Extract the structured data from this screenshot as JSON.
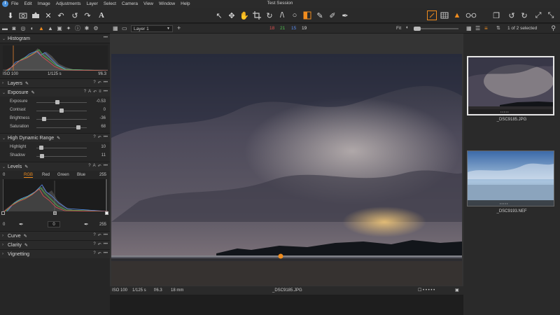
{
  "window_title": "Test Session",
  "menu": [
    "File",
    "Edit",
    "Image",
    "Adjustments",
    "Layer",
    "Select",
    "Camera",
    "View",
    "Window",
    "Help"
  ],
  "colors": {
    "accent": "#f08c1e",
    "panel_bg": "#262626",
    "toolbar_bg": "#2a2a2a"
  },
  "toolbar": {
    "left_icons": [
      "import-icon",
      "camera-icon",
      "export-icon",
      "delete-icon",
      "undo-icon",
      "rotate-left-icon",
      "redo-icon",
      "text-icon"
    ],
    "center_icons": [
      "pointer-icon",
      "pan-icon",
      "hand-icon",
      "crop-icon",
      "rotate-icon",
      "keystone-icon",
      "spot-icon",
      "mask-icon",
      "brush-icon",
      "eraser-icon",
      "gradient-icon",
      "picker-icon"
    ],
    "right_icons": [
      "proof-icon",
      "grid-icon",
      "warning-icon",
      "glasses-icon",
      "copy-icon",
      "reset-icon",
      "sync-icon",
      "expand-icon",
      "compress-icon"
    ]
  },
  "left": {
    "histogram": {
      "title": "Histogram",
      "iso": "ISO 100",
      "shutter": "1/125 s",
      "aperture": "f/6.3"
    },
    "layers_title": "Layers",
    "exposure": {
      "title": "Exposure",
      "sliders": [
        {
          "label": "Exposure",
          "value": "-0.53",
          "pos": 0.42
        },
        {
          "label": "Contrast",
          "value": "0",
          "pos": 0.5
        },
        {
          "label": "Brightness",
          "value": "-36",
          "pos": 0.15
        },
        {
          "label": "Saturation",
          "value": "68",
          "pos": 0.83
        }
      ]
    },
    "hdr": {
      "title": "High Dynamic Range",
      "sliders": [
        {
          "label": "Highlight",
          "value": "10",
          "pos": 0.1
        },
        {
          "label": "Shadow",
          "value": "11",
          "pos": 0.11
        }
      ]
    },
    "levels": {
      "title": "Levels",
      "input_low": "0",
      "input_high": "255",
      "channels": [
        "RGB",
        "Red",
        "Green",
        "Blue"
      ],
      "output_low": "0",
      "output_mid": "0",
      "output_high": "255"
    },
    "collapsed": [
      "Curve",
      "Clarity",
      "Vignetting"
    ]
  },
  "viewer": {
    "layer_select": "Layer 1",
    "counts": {
      "red": "18",
      "green": "21",
      "blue": "15",
      "white": "19"
    },
    "zoom_label": "Fit",
    "footer": {
      "iso": "ISO 100",
      "shutter": "1/125 s",
      "aperture": "f/6.3",
      "focal": "18 mm",
      "filename": "_DSC9185.JPG"
    }
  },
  "browser": {
    "selection": "1 of 2 selected",
    "items": [
      {
        "name": "_DSC9185.JPG",
        "selected": true
      },
      {
        "name": "_DSC9193.NEF",
        "selected": false
      }
    ]
  }
}
